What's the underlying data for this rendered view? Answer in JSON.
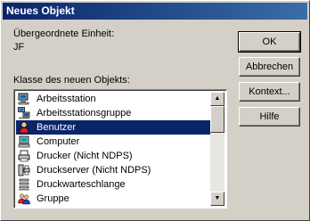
{
  "window": {
    "title": "Neues Objekt"
  },
  "parent_unit": {
    "label": "Übergeordnete Einheit:",
    "value": "JF"
  },
  "class_list": {
    "label": "Klasse des neuen Objekts:",
    "items": [
      {
        "label": "Arbeitsstation",
        "icon": "workstation-icon",
        "selected": false
      },
      {
        "label": "Arbeitsstationsgruppe",
        "icon": "workstation-group-icon",
        "selected": false
      },
      {
        "label": "Benutzer",
        "icon": "user-icon",
        "selected": true
      },
      {
        "label": "Computer",
        "icon": "computer-icon",
        "selected": false
      },
      {
        "label": "Drucker (Nicht NDPS)",
        "icon": "printer-icon",
        "selected": false
      },
      {
        "label": "Druckserver (Nicht NDPS)",
        "icon": "print-server-icon",
        "selected": false
      },
      {
        "label": "Druckwarteschlange",
        "icon": "print-queue-icon",
        "selected": false
      },
      {
        "label": "Gruppe",
        "icon": "group-icon",
        "selected": false
      }
    ]
  },
  "buttons": {
    "ok": "OK",
    "cancel": "Abbrechen",
    "context": "Kontext...",
    "help": "Hilfe"
  },
  "colors": {
    "titlebar": "#0a246a",
    "selection": "#0a246a",
    "face": "#d4d0c8"
  }
}
